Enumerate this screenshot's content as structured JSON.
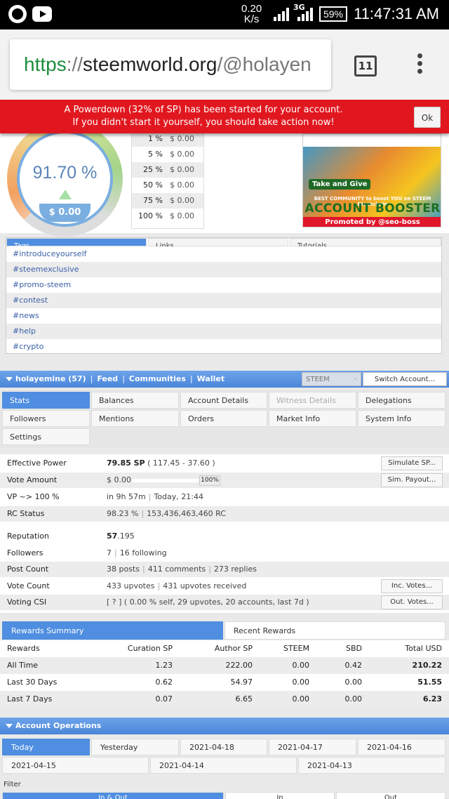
{
  "status_bar": {
    "net_speed": "0.20",
    "net_unit": "K/s",
    "network_type": "3G",
    "battery": "59%",
    "time": "11:47:31 AM"
  },
  "browser": {
    "url_scheme": "https",
    "url_sep": "://",
    "url_host": "steemworld.org",
    "url_path": "/@holayen",
    "tab_count": "11"
  },
  "alert": {
    "line1": "A Powerdown (32% of SP) has been started for your account.",
    "line2": "If you didn't start it yourself, you should take action now!",
    "ok_label": "Ok"
  },
  "voting_power": {
    "percent": "91.70 %",
    "value": "$ 0.00"
  },
  "vote_values": [
    {
      "pct": "1 %",
      "amt": "$ 0.00"
    },
    {
      "pct": "5 %",
      "amt": "$ 0.00"
    },
    {
      "pct": "25 %",
      "amt": "$ 0.00"
    },
    {
      "pct": "50 %",
      "amt": "$ 0.00"
    },
    {
      "pct": "75 %",
      "amt": "$ 0.00"
    },
    {
      "pct": "100 %",
      "amt": "$ 0.00"
    }
  ],
  "banner": {
    "tag": "Take and Give",
    "line1": "BEST COMMUNITY to boost YOU on STEEM Blockchain",
    "title": "ACCOUNT BOOSTER",
    "promo": "Promoted by @seo-boss"
  },
  "tags_panel": {
    "tabs": [
      "Tags",
      "Links",
      "Tutorials"
    ],
    "items": [
      "#introduceyourself",
      "#steemexclusive",
      "#promo-steem",
      "#contest",
      "#news",
      "#help",
      "#crypto"
    ]
  },
  "account_nav": {
    "account": "holayemine (57)",
    "links": [
      "Feed",
      "Communities",
      "Wallet"
    ],
    "currency": "STEEM",
    "switch_label": "Switch Account..."
  },
  "nav_buttons": {
    "row1": [
      "Stats",
      "Balances",
      "Account Details",
      "Witness Details",
      "Delegations"
    ],
    "row2": [
      "Followers",
      "Mentions",
      "Orders",
      "Market Info",
      "System Info"
    ],
    "row3": [
      "Settings"
    ]
  },
  "stats": {
    "effective_power_label": "Effective Power",
    "effective_power_value": "79.85 SP",
    "effective_power_detail": "( 117.45 - 37.60 )",
    "simulate_label": "Simulate SP...",
    "vote_amount_label": "Vote Amount",
    "vote_amount_value": "$ 0.00",
    "vote_amount_pct": "100%",
    "vote_amount_fill": 1.0,
    "sim_payout_label": "Sim. Payout...",
    "vp_label": "VP ~> 100 %",
    "vp_time": "in 9h 57m",
    "vp_when": "Today, 21:44",
    "rc_label": "RC Status",
    "rc_pct": "98.23 %",
    "rc_value": "153,436,463,460 RC",
    "reputation_label": "Reputation",
    "reputation_main": "57",
    "reputation_dec": ".195",
    "followers_label": "Followers",
    "followers_count": "7",
    "following": "16 following",
    "post_count_label": "Post Count",
    "posts": "38 posts",
    "comments": "411 comments",
    "replies": "273 replies",
    "vote_count_label": "Vote Count",
    "upvotes": "433 upvotes",
    "upvotes_received": "431 upvotes received",
    "inc_votes_label": "Inc. Votes...",
    "csi_label": "Voting CSI",
    "csi_value": "[ ? ] ( 0.00 % self, 29 upvotes, 20 accounts, last 7d )",
    "out_votes_label": "Out. Votes..."
  },
  "rewards": {
    "tabs": [
      "Rewards Summary",
      "Recent Rewards"
    ],
    "headers": [
      "Rewards",
      "Curation SP",
      "Author SP",
      "STEEM",
      "SBD",
      "Total USD"
    ],
    "rows": [
      [
        "All Time",
        "1.23",
        "222.00",
        "0.00",
        "0.42",
        "210.22"
      ],
      [
        "Last 30 Days",
        "0.62",
        "54.97",
        "0.00",
        "0.00",
        "51.55"
      ],
      [
        "Last 7 Days",
        "0.07",
        "6.65",
        "0.00",
        "0.00",
        "6.23"
      ]
    ]
  },
  "operations": {
    "title": "Account Operations",
    "days_row1": [
      "Today",
      "Yesterday",
      "2021-04-18",
      "2021-04-17",
      "2021-04-16"
    ],
    "days_row2": [
      "2021-04-15",
      "2021-04-14",
      "2021-04-13"
    ],
    "filter_label": "Filter",
    "filter_tabs": [
      "In & Out",
      "In",
      "Out"
    ]
  }
}
